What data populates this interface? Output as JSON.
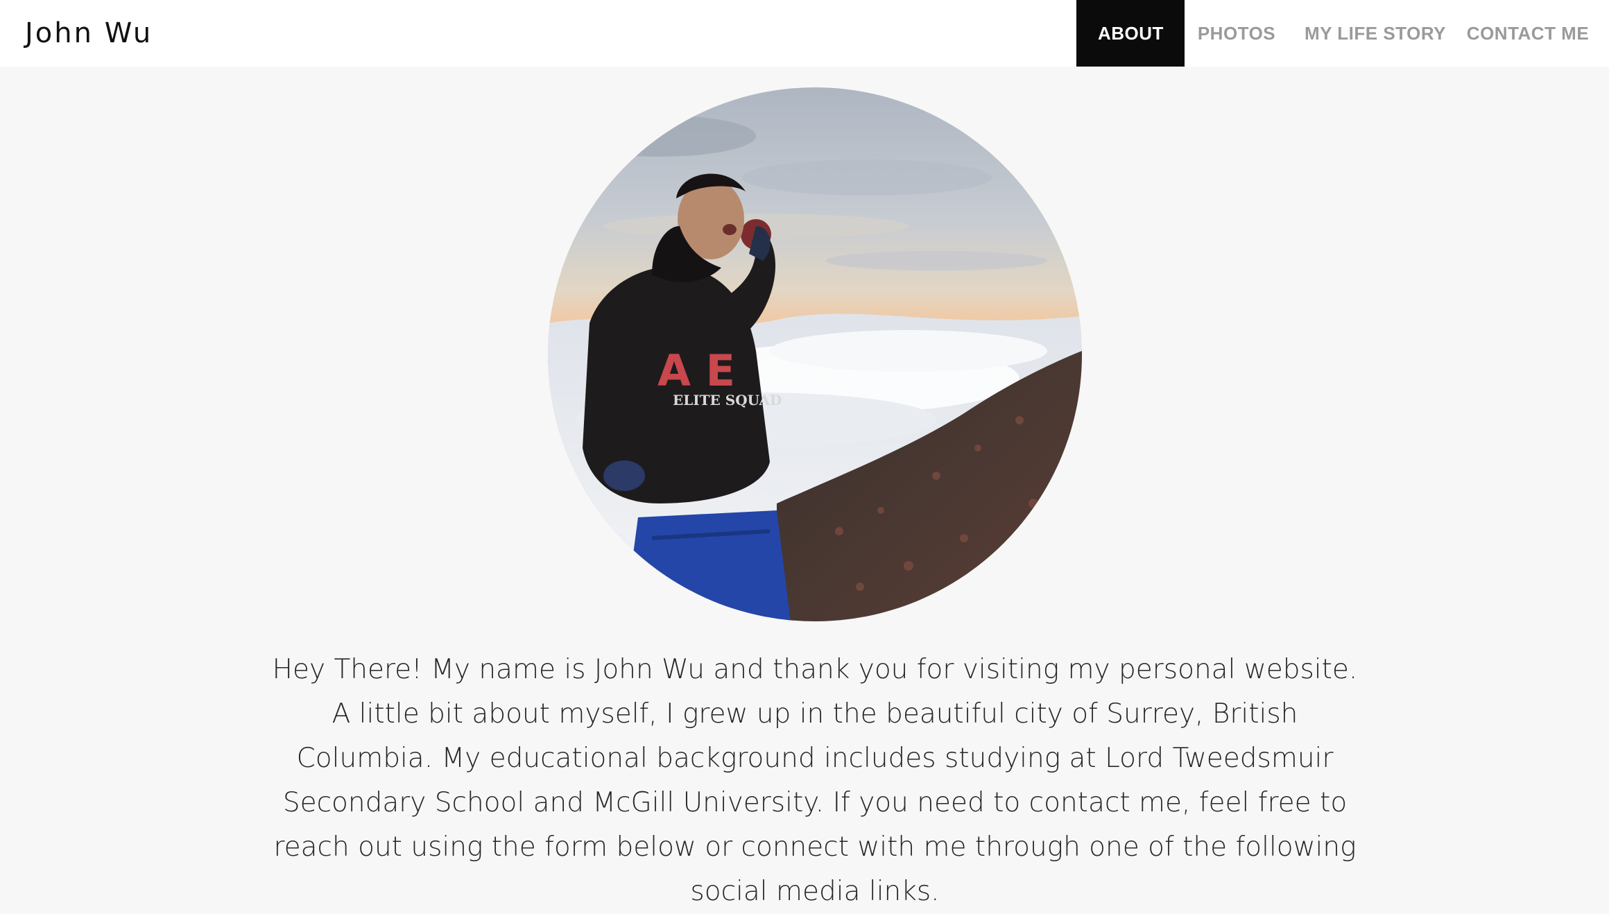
{
  "site": {
    "brand": "John Wu"
  },
  "nav": {
    "items": [
      {
        "label": "ABOUT",
        "active": true
      },
      {
        "label": "PHOTOS",
        "active": false
      },
      {
        "label": "MY LIFE STORY",
        "active": false
      },
      {
        "label": "CONTACT ME",
        "active": false
      }
    ]
  },
  "hero": {
    "photo_alt": "profile-photo",
    "shirt_text_main": "A E",
    "shirt_text_sub": "ELITE SQUAD"
  },
  "about": {
    "text": "Hey There! My name is John Wu and thank you for visiting my personal website. A little bit about myself, I grew up in the beautiful city of Surrey, British Columbia. My educational background includes studying at Lord Tweedsmuir Secondary School and McGill University. If you need to contact me, feel free to reach out using the form below or connect with me through one of the following social media links."
  },
  "colors": {
    "page_bg": "#f7f7f7",
    "nav_active_bg": "#0b0b0b",
    "nav_inactive_text": "#9a9a9a"
  }
}
